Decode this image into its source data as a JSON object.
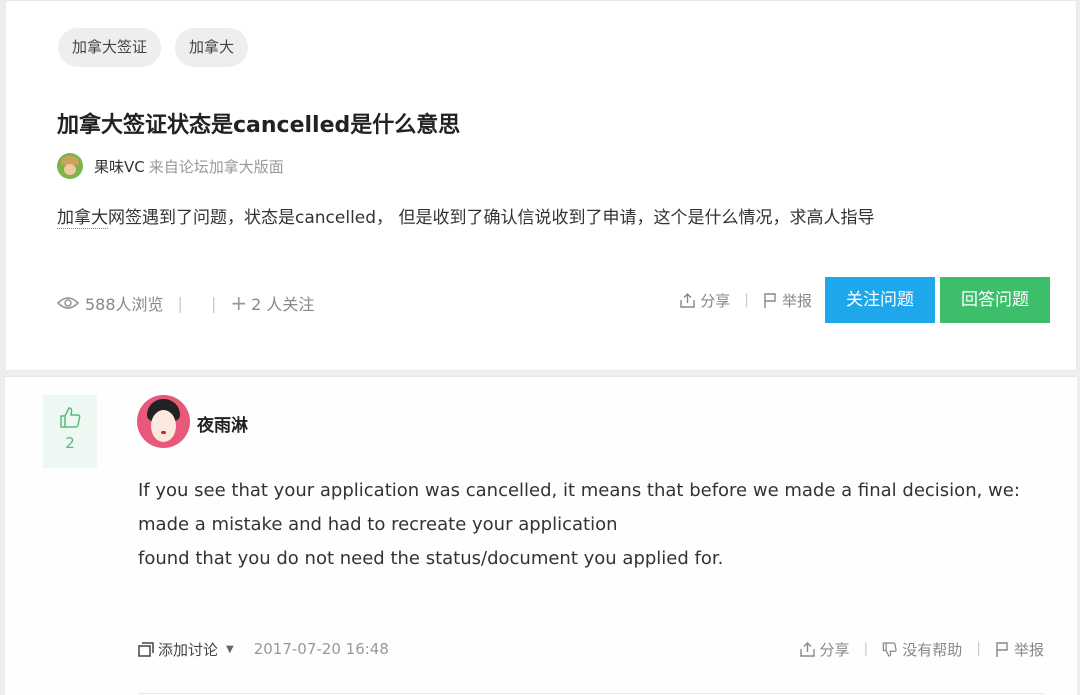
{
  "tags": [
    "加拿大签证",
    "加拿大"
  ],
  "question": {
    "title": "加拿大签证状态是cancelled是什么意思",
    "author": "果味VC",
    "source": "来自论坛加拿大版面",
    "body_first": "加拿大",
    "body_rest": "网签遇到了问题，状态是cancelled， 但是收到了确认信说收到了申请，这个是什么情况，求高人指导",
    "views": "588人浏览",
    "followers": "2 人关注",
    "share_label": "分享",
    "report_label": "举报",
    "follow_button": "关注问题",
    "answer_button": "回答问题"
  },
  "answer": {
    "votes": "2",
    "author": "夜雨淋",
    "lines": [
      "If you see that your application was cancelled, it means that before we made a final decision, we:",
      "made a mistake and had to recreate your application",
      "found that you do not need the status/document you applied for."
    ],
    "discuss_label": "添加讨论",
    "timestamp": "2017-07-20 16:48",
    "share_label": "分享",
    "unhelpful_label": "没有帮助",
    "report_label": "举报"
  },
  "colors": {
    "follow_button": "#1ea7ea",
    "answer_button": "#3cbe6a",
    "vote_accent": "#5fb87d"
  },
  "icons": [
    "eye-icon",
    "plus-icon",
    "share-icon",
    "flag-icon",
    "thumbs-up-icon",
    "comment-icon",
    "thumbs-down-icon",
    "caret-down-icon"
  ]
}
